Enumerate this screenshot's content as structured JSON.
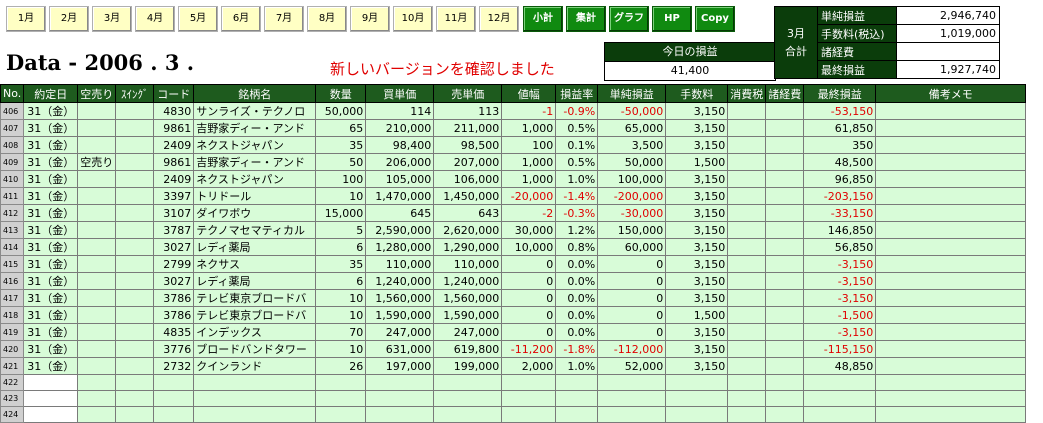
{
  "toolbar": {
    "months": [
      "1月",
      "2月",
      "3月",
      "4月",
      "5月",
      "6月",
      "7月",
      "8月",
      "9月",
      "10月",
      "11月",
      "12月"
    ],
    "actions": [
      "小計",
      "集計",
      "グラフ",
      "HP",
      "Copy"
    ]
  },
  "title": "Data - 2006 . 3 .",
  "notice": "新しいバージョンを確認しました",
  "today": {
    "label": "今日の損益",
    "value": "41,400"
  },
  "summary": {
    "month_label_1": "3月",
    "month_label_2": "合計",
    "rows": [
      {
        "label": "単純損益",
        "value": "2,946,740"
      },
      {
        "label": "手数料(税込)",
        "value": "1,019,000"
      },
      {
        "label": "諸経費",
        "value": ""
      },
      {
        "label": "最終損益",
        "value": "1,927,740"
      }
    ]
  },
  "table": {
    "headers": [
      "No.",
      "約定日",
      "空売り",
      "ｽｲﾝｸﾞ",
      "コード",
      "銘柄名",
      "数量",
      "買単価",
      "売単価",
      "値幅",
      "損益率",
      "単純損益",
      "手数料",
      "消費税",
      "諸経費",
      "最終損益",
      "備考メモ"
    ],
    "rows": [
      {
        "no": "406",
        "date": "31（金）",
        "short": "",
        "swing": "",
        "code": "4830",
        "name": "サンライズ・テクノロ",
        "qty": "50,000",
        "buy": "114",
        "sell": "113",
        "diff": "-1",
        "rate": "-0.9%",
        "pl": "-50,000",
        "fee": "3,150",
        "tax": "",
        "misc": "",
        "final": "-53,150",
        "memo": ""
      },
      {
        "no": "407",
        "date": "31（金）",
        "short": "",
        "swing": "",
        "code": "9861",
        "name": "吉野家ディー・アンド",
        "qty": "65",
        "buy": "210,000",
        "sell": "211,000",
        "diff": "1,000",
        "rate": "0.5%",
        "pl": "65,000",
        "fee": "3,150",
        "tax": "",
        "misc": "",
        "final": "61,850",
        "memo": ""
      },
      {
        "no": "408",
        "date": "31（金）",
        "short": "",
        "swing": "",
        "code": "2409",
        "name": "ネクストジャパン",
        "qty": "35",
        "buy": "98,400",
        "sell": "98,500",
        "diff": "100",
        "rate": "0.1%",
        "pl": "3,500",
        "fee": "3,150",
        "tax": "",
        "misc": "",
        "final": "350",
        "memo": ""
      },
      {
        "no": "409",
        "date": "31（金）",
        "short": "空売り",
        "swing": "",
        "code": "9861",
        "name": "吉野家ディー・アンド",
        "qty": "50",
        "buy": "206,000",
        "sell": "207,000",
        "diff": "1,000",
        "rate": "0.5%",
        "pl": "50,000",
        "fee": "1,500",
        "tax": "",
        "misc": "",
        "final": "48,500",
        "memo": ""
      },
      {
        "no": "410",
        "date": "31（金）",
        "short": "",
        "swing": "",
        "code": "2409",
        "name": "ネクストジャパン",
        "qty": "100",
        "buy": "105,000",
        "sell": "106,000",
        "diff": "1,000",
        "rate": "1.0%",
        "pl": "100,000",
        "fee": "3,150",
        "tax": "",
        "misc": "",
        "final": "96,850",
        "memo": ""
      },
      {
        "no": "411",
        "date": "31（金）",
        "short": "",
        "swing": "",
        "code": "3397",
        "name": "トリドール",
        "qty": "10",
        "buy": "1,470,000",
        "sell": "1,450,000",
        "diff": "-20,000",
        "rate": "-1.4%",
        "pl": "-200,000",
        "fee": "3,150",
        "tax": "",
        "misc": "",
        "final": "-203,150",
        "memo": ""
      },
      {
        "no": "412",
        "date": "31（金）",
        "short": "",
        "swing": "",
        "code": "3107",
        "name": "ダイワボウ",
        "qty": "15,000",
        "buy": "645",
        "sell": "643",
        "diff": "-2",
        "rate": "-0.3%",
        "pl": "-30,000",
        "fee": "3,150",
        "tax": "",
        "misc": "",
        "final": "-33,150",
        "memo": ""
      },
      {
        "no": "413",
        "date": "31（金）",
        "short": "",
        "swing": "",
        "code": "3787",
        "name": "テクノマセマティカル",
        "qty": "5",
        "buy": "2,590,000",
        "sell": "2,620,000",
        "diff": "30,000",
        "rate": "1.2%",
        "pl": "150,000",
        "fee": "3,150",
        "tax": "",
        "misc": "",
        "final": "146,850",
        "memo": ""
      },
      {
        "no": "414",
        "date": "31（金）",
        "short": "",
        "swing": "",
        "code": "3027",
        "name": "レディ薬局",
        "qty": "6",
        "buy": "1,280,000",
        "sell": "1,290,000",
        "diff": "10,000",
        "rate": "0.8%",
        "pl": "60,000",
        "fee": "3,150",
        "tax": "",
        "misc": "",
        "final": "56,850",
        "memo": ""
      },
      {
        "no": "415",
        "date": "31（金）",
        "short": "",
        "swing": "",
        "code": "2799",
        "name": "ネクサス",
        "qty": "35",
        "buy": "110,000",
        "sell": "110,000",
        "diff": "0",
        "rate": "0.0%",
        "pl": "0",
        "fee": "3,150",
        "tax": "",
        "misc": "",
        "final": "-3,150",
        "memo": ""
      },
      {
        "no": "416",
        "date": "31（金）",
        "short": "",
        "swing": "",
        "code": "3027",
        "name": "レディ薬局",
        "qty": "6",
        "buy": "1,240,000",
        "sell": "1,240,000",
        "diff": "0",
        "rate": "0.0%",
        "pl": "0",
        "fee": "3,150",
        "tax": "",
        "misc": "",
        "final": "-3,150",
        "memo": ""
      },
      {
        "no": "417",
        "date": "31（金）",
        "short": "",
        "swing": "",
        "code": "3786",
        "name": "テレビ東京ブロードバ",
        "qty": "10",
        "buy": "1,560,000",
        "sell": "1,560,000",
        "diff": "0",
        "rate": "0.0%",
        "pl": "0",
        "fee": "3,150",
        "tax": "",
        "misc": "",
        "final": "-3,150",
        "memo": ""
      },
      {
        "no": "418",
        "date": "31（金）",
        "short": "",
        "swing": "",
        "code": "3786",
        "name": "テレビ東京ブロードバ",
        "qty": "10",
        "buy": "1,590,000",
        "sell": "1,590,000",
        "diff": "0",
        "rate": "0.0%",
        "pl": "0",
        "fee": "1,500",
        "tax": "",
        "misc": "",
        "final": "-1,500",
        "memo": ""
      },
      {
        "no": "419",
        "date": "31（金）",
        "short": "",
        "swing": "",
        "code": "4835",
        "name": "インデックス",
        "qty": "70",
        "buy": "247,000",
        "sell": "247,000",
        "diff": "0",
        "rate": "0.0%",
        "pl": "0",
        "fee": "3,150",
        "tax": "",
        "misc": "",
        "final": "-3,150",
        "memo": ""
      },
      {
        "no": "420",
        "date": "31（金）",
        "short": "",
        "swing": "",
        "code": "3776",
        "name": "ブロードバンドタワー",
        "qty": "10",
        "buy": "631,000",
        "sell": "619,800",
        "diff": "-11,200",
        "rate": "-1.8%",
        "pl": "-112,000",
        "fee": "3,150",
        "tax": "",
        "misc": "",
        "final": "-115,150",
        "memo": ""
      },
      {
        "no": "421",
        "date": "31（金）",
        "short": "",
        "swing": "",
        "code": "2732",
        "name": "クインランド",
        "qty": "26",
        "buy": "197,000",
        "sell": "199,000",
        "diff": "2,000",
        "rate": "1.0%",
        "pl": "52,000",
        "fee": "3,150",
        "tax": "",
        "misc": "",
        "final": "48,850",
        "memo": ""
      },
      {
        "no": "422",
        "date": "",
        "short": "",
        "swing": "",
        "code": "",
        "name": "",
        "qty": "",
        "buy": "",
        "sell": "",
        "diff": "",
        "rate": "",
        "pl": "",
        "fee": "",
        "tax": "",
        "misc": "",
        "final": "",
        "memo": ""
      },
      {
        "no": "423",
        "date": "",
        "short": "",
        "swing": "",
        "code": "",
        "name": "",
        "qty": "",
        "buy": "",
        "sell": "",
        "diff": "",
        "rate": "",
        "pl": "",
        "fee": "",
        "tax": "",
        "misc": "",
        "final": "",
        "memo": ""
      },
      {
        "no": "424",
        "date": "",
        "short": "",
        "swing": "",
        "code": "",
        "name": "",
        "qty": "",
        "buy": "",
        "sell": "",
        "diff": "",
        "rate": "",
        "pl": "",
        "fee": "",
        "tax": "",
        "misc": "",
        "final": "",
        "memo": ""
      }
    ]
  },
  "colors": {
    "header_green": "#1e5b1e",
    "cell_green": "#d8fcd8",
    "negative": "#e00000",
    "button_green": "#108a10",
    "month_button": "#ffffc4"
  },
  "icons": []
}
